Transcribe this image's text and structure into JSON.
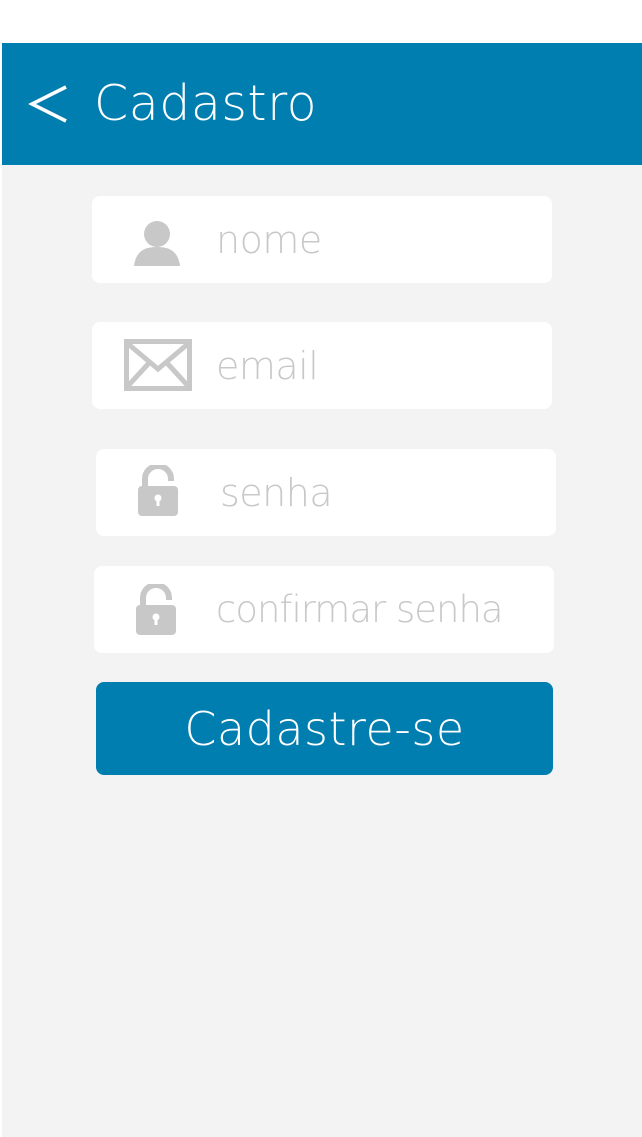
{
  "header": {
    "title": "Cadastro",
    "back_icon": "chevron-left-icon",
    "color": "#007eb0"
  },
  "form": {
    "name": {
      "placeholder": "nome",
      "value": "",
      "icon": "user-icon"
    },
    "email": {
      "placeholder": "email",
      "value": "",
      "icon": "envelope-icon"
    },
    "password": {
      "placeholder": "senha",
      "value": "",
      "icon": "lock-icon"
    },
    "confirm_password": {
      "placeholder": "confirmar senha",
      "value": "",
      "icon": "lock-icon"
    },
    "submit_label": "Cadastre-se"
  },
  "colors": {
    "accent": "#007eb0",
    "background": "#f3f3f3",
    "field": "#ffffff",
    "icon": "#c8c8c8"
  }
}
